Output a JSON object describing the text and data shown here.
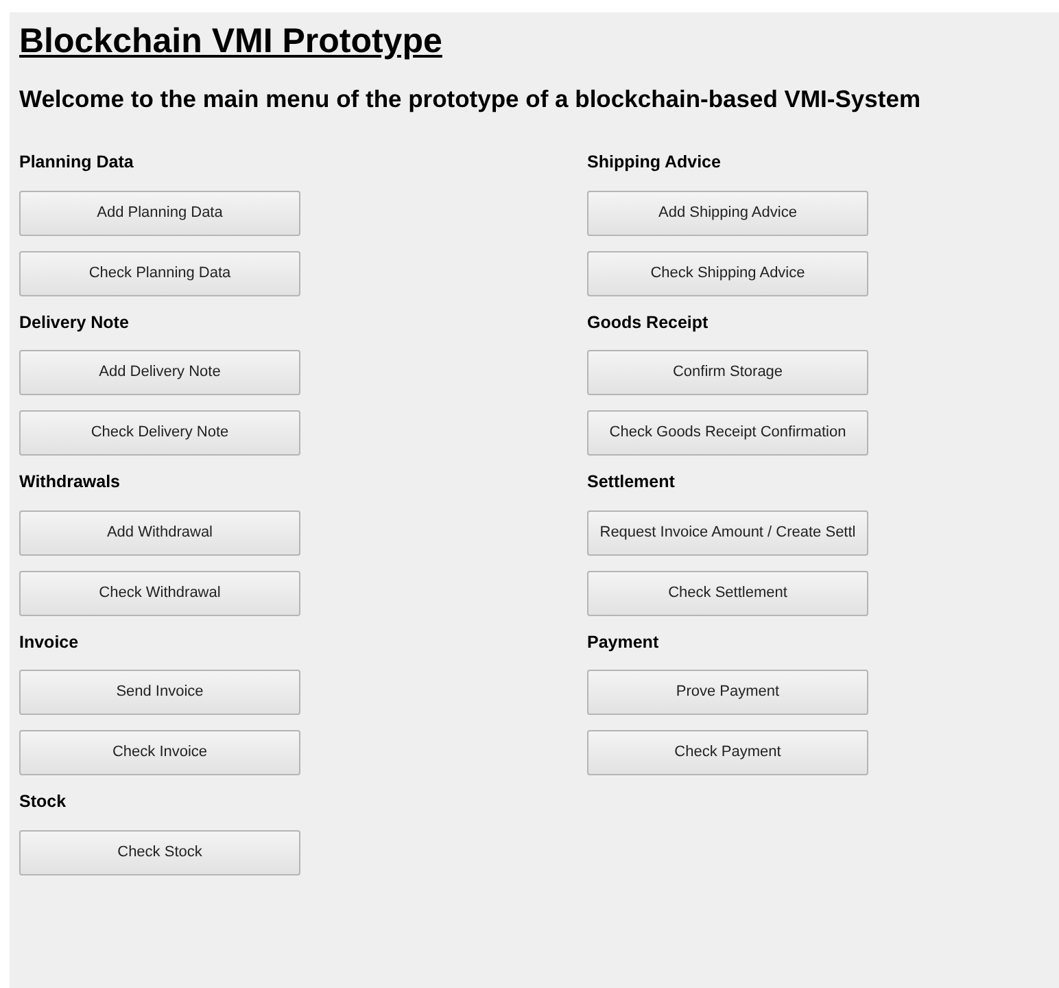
{
  "title": "Blockchain VMI Prototype",
  "subtitle": "Welcome to the main menu of the prototype of a blockchain-based VMI-System",
  "sections": [
    {
      "heading": "Planning Data",
      "buttons": [
        "Add Planning Data",
        "Check Planning Data"
      ]
    },
    {
      "heading": "Shipping Advice",
      "buttons": [
        "Add Shipping Advice",
        "Check Shipping Advice"
      ]
    },
    {
      "heading": "Delivery Note",
      "buttons": [
        "Add Delivery Note",
        "Check Delivery Note"
      ]
    },
    {
      "heading": "Goods Receipt",
      "buttons": [
        "Confirm Storage",
        "Check Goods Receipt Confirmation"
      ]
    },
    {
      "heading": "Withdrawals",
      "buttons": [
        "Add Withdrawal",
        "Check Withdrawal"
      ]
    },
    {
      "heading": "Settlement",
      "buttons": [
        "Request Invoice Amount / Create Settl",
        "Check Settlement"
      ]
    },
    {
      "heading": "Invoice",
      "buttons": [
        "Send Invoice",
        "Check Invoice"
      ]
    },
    {
      "heading": "Payment",
      "buttons": [
        "Prove Payment",
        "Check Payment"
      ]
    },
    {
      "heading": "Stock",
      "buttons": [
        "Check Stock"
      ]
    }
  ]
}
